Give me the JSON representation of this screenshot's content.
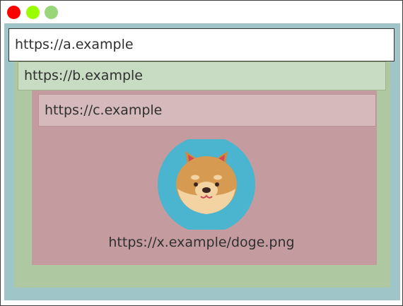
{
  "window": {
    "buttons": [
      {
        "name": "close",
        "color": "#ff0000"
      },
      {
        "name": "minimize",
        "color": "#99ff00"
      },
      {
        "name": "maximize",
        "color": "#99d67a"
      }
    ]
  },
  "frames": {
    "a": {
      "url": "https://a.example",
      "color": "#9fc5c8"
    },
    "b": {
      "url": "https://b.example",
      "color": "#aec9a2"
    },
    "c": {
      "url": "https://c.example",
      "color": "#c49c9f"
    }
  },
  "image": {
    "icon": "shiba-dog-icon",
    "caption": "https://x.example/doge.png"
  }
}
